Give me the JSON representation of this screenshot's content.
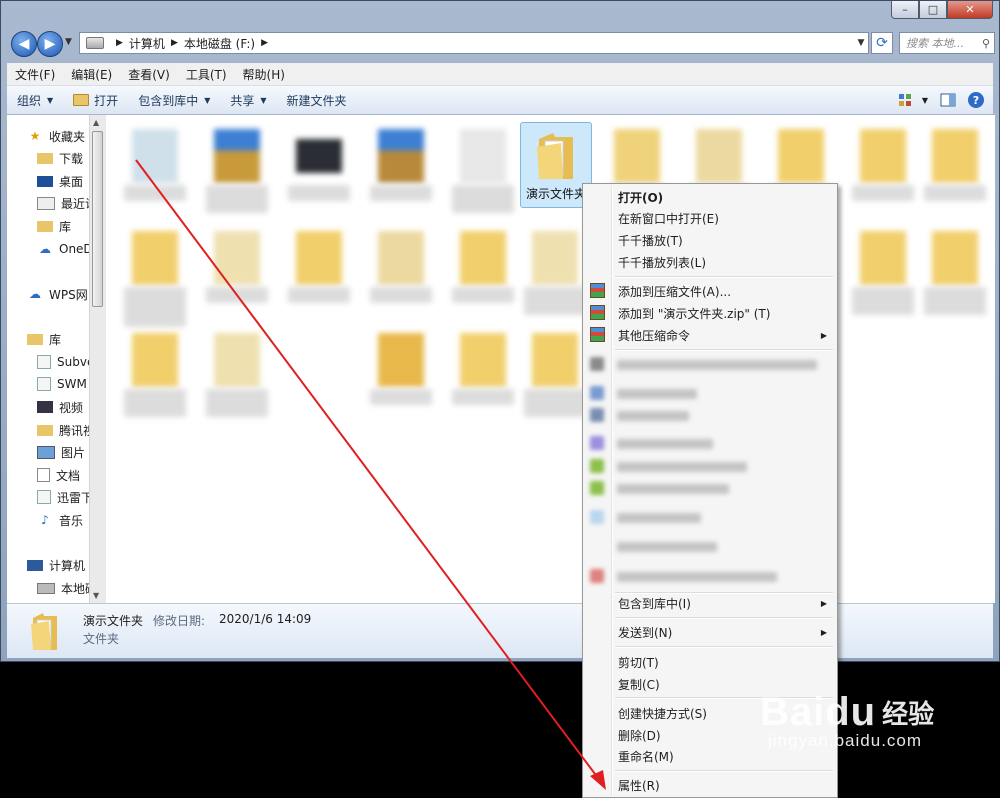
{
  "window": {
    "caption_buttons": {
      "minimize": "–",
      "maximize": "□",
      "close": "✕"
    }
  },
  "address": {
    "crumbs": [
      "计算机",
      "本地磁盘 (F:)"
    ],
    "search_placeholder": "搜索 本地..."
  },
  "menubar": [
    "文件(F)",
    "编辑(E)",
    "查看(V)",
    "工具(T)",
    "帮助(H)"
  ],
  "toolbar": {
    "organize": "组织",
    "open": "打开",
    "include_in_library": "包含到库中",
    "share": "共享",
    "new_folder": "新建文件夹"
  },
  "navpane": {
    "favorites": "收藏夹",
    "downloads": "下载",
    "desktop": "桌面",
    "recent": "最近访",
    "library_fav": "库",
    "onedrive": "OneD",
    "wps": "WPS网",
    "libraries": "库",
    "subversion": "Subve",
    "swm": "SWM",
    "videos": "视频",
    "tencent": "腾讯视",
    "pictures": "图片",
    "documents": "文档",
    "thunder": "迅雷下",
    "music": "音乐",
    "computer": "计算机",
    "local_disk": "本地磁"
  },
  "content": {
    "selected_name": "演示文件夹"
  },
  "details": {
    "name": "演示文件夹",
    "modified_label": "修改日期:",
    "modified_value": "2020/1/6 14:09",
    "type": "文件夹"
  },
  "context_menu": {
    "open": "打开(O)",
    "open_new_window": "在新窗口中打开(E)",
    "qq_play": "千千播放(T)",
    "qq_playlist": "千千播放列表(L)",
    "add_to_archive": "添加到压缩文件(A)...",
    "add_to_zip": "添加到 \"演示文件夹.zip\" (T)",
    "other_compress": "其他压缩命令",
    "include_in_library": "包含到库中(I)",
    "send_to": "发送到(N)",
    "cut": "剪切(T)",
    "copy": "复制(C)",
    "create_shortcut": "创建快捷方式(S)",
    "delete": "删除(D)",
    "rename": "重命名(M)",
    "properties": "属性(R)"
  },
  "watermark": {
    "brand": "Baidu",
    "brand_cn": "经验",
    "url": "jingyan.baidu.com"
  },
  "colors": {
    "annotation_arrow": "#e02020",
    "selection": "#cde8fb",
    "folder": "#f1cf6b"
  }
}
